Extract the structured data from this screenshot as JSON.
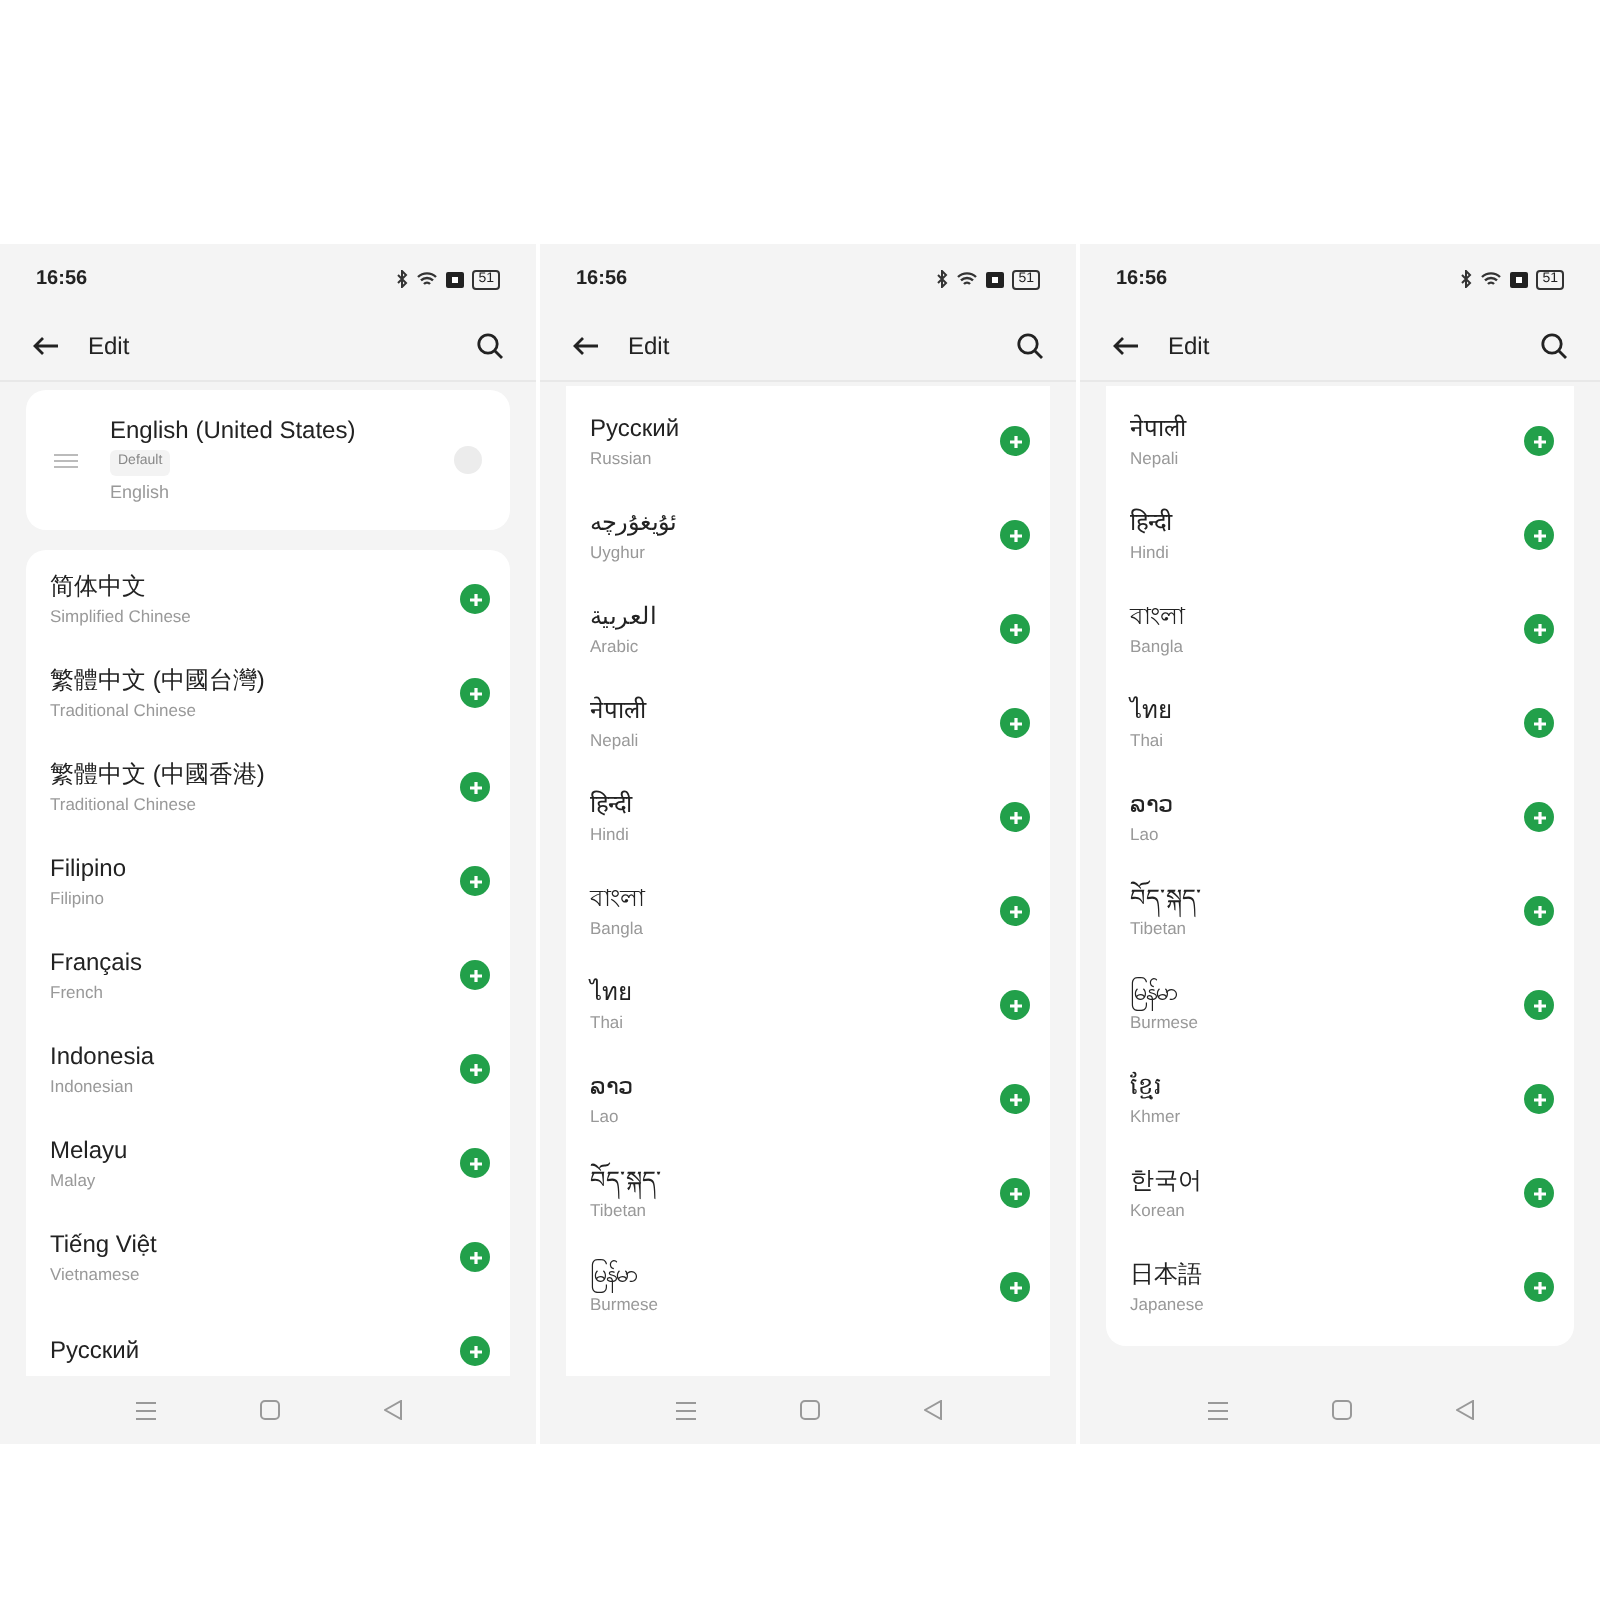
{
  "screens": [
    {
      "status": {
        "time": "16:56",
        "battery": "51"
      },
      "title": "Edit",
      "scrolled": false,
      "default_language": {
        "name": "English (United States)",
        "badge": "Default",
        "english": "English"
      },
      "languages": [
        {
          "name": "简体中文",
          "english": "Simplified Chinese"
        },
        {
          "name": "繁體中文 (中國台灣)",
          "english": "Traditional Chinese"
        },
        {
          "name": "繁體中文 (中國香港)",
          "english": "Traditional Chinese"
        },
        {
          "name": "Filipino",
          "english": "Filipino"
        },
        {
          "name": "Français",
          "english": "French"
        },
        {
          "name": "Indonesia",
          "english": "Indonesian"
        },
        {
          "name": "Melayu",
          "english": "Malay"
        },
        {
          "name": "Tiếng Việt",
          "english": "Vietnamese"
        },
        {
          "name": "Русский"
        }
      ]
    },
    {
      "status": {
        "time": "16:56",
        "battery": "51"
      },
      "title": "Edit",
      "scrolled": false,
      "languages": [
        {
          "name": "Русский",
          "english": "Russian"
        },
        {
          "name": "ئۇيغۇرچە",
          "english": "Uyghur"
        },
        {
          "name": "العربية",
          "english": "Arabic"
        },
        {
          "name": "नेपाली",
          "english": "Nepali"
        },
        {
          "name": "हिन्दी",
          "english": "Hindi"
        },
        {
          "name": "বাংলা",
          "english": "Bangla"
        },
        {
          "name": "ไทย",
          "english": "Thai"
        },
        {
          "name": "ລາວ",
          "english": "Lao"
        },
        {
          "name": "བོད་སྐད་",
          "english": "Tibetan"
        },
        {
          "name": "မြန်မာ",
          "english": "Burmese"
        }
      ]
    },
    {
      "status": {
        "time": "16:56",
        "battery": "51"
      },
      "title": "Edit",
      "scrolled": true,
      "languages": [
        {
          "name": "नेपाली",
          "english": "Nepali"
        },
        {
          "name": "हिन्दी",
          "english": "Hindi"
        },
        {
          "name": "বাংলা",
          "english": "Bangla"
        },
        {
          "name": "ไทย",
          "english": "Thai"
        },
        {
          "name": "ລາວ",
          "english": "Lao"
        },
        {
          "name": "བོད་སྐད་",
          "english": "Tibetan"
        },
        {
          "name": "မြန်မာ",
          "english": "Burmese"
        },
        {
          "name": "ខ្មែរ",
          "english": "Khmer"
        },
        {
          "name": "한국어",
          "english": "Korean"
        },
        {
          "name": "日本語",
          "english": "Japanese"
        }
      ]
    }
  ]
}
